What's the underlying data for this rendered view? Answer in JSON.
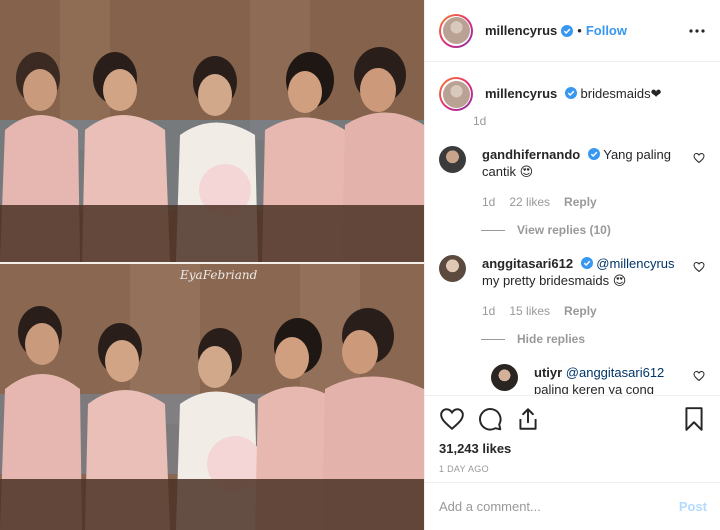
{
  "header": {
    "username": "millencyrus",
    "separator": "•",
    "follow_label": "Follow",
    "more_icon": "more-horizontal-icon"
  },
  "media": {
    "watermark": "EyaFebriand"
  },
  "caption": {
    "username": "millencyrus",
    "text": "bridesmaids❤",
    "time": "1d"
  },
  "comments": [
    {
      "username": "gandhifernando",
      "text": "Yang paling cantik 😍",
      "time": "1d",
      "likes": "22 likes",
      "reply_label": "Reply",
      "replies_toggle": "View replies (10)"
    },
    {
      "username": "anggitasari612",
      "mention": "@millencyrus",
      "text": "my pretty bridesmaids 😍",
      "time": "1d",
      "likes": "15 likes",
      "reply_label": "Reply",
      "replies_toggle": "Hide replies"
    }
  ],
  "reply": {
    "username": "utiyr",
    "mention": "@anggitasari612",
    "text": "paling keren ya cong dese 😍♥"
  },
  "actions": {
    "likes": "31,243 likes",
    "date": "1 DAY AGO"
  },
  "add_comment": {
    "placeholder": "Add a comment...",
    "post_label": "Post"
  },
  "colors": {
    "link": "#3897f0",
    "verified": "#3897f0",
    "muted": "#999999",
    "post_disabled": "#b3dbff"
  }
}
